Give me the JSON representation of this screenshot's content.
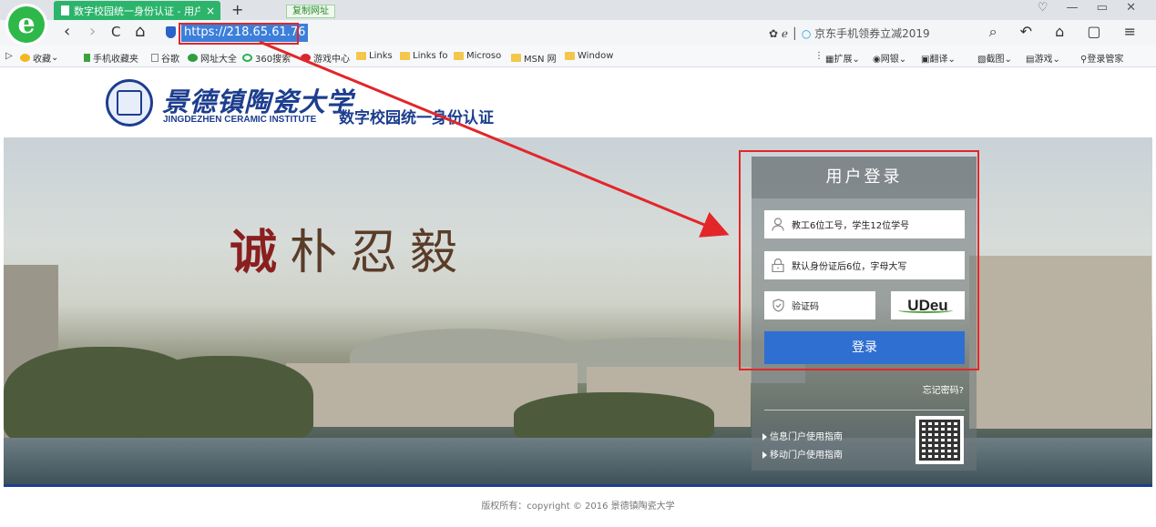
{
  "browser": {
    "tab_title": "数字校园统一身份认证 - 用户登录",
    "tab_close": "×",
    "new_tab": "+",
    "copy_url_label": "复制网址",
    "url": "https://218.65.61.76",
    "search_text": "京东手机领券立减2019",
    "window_controls": "♡ — ▭ ✕",
    "nav": {
      "back": "‹",
      "forward": "›",
      "refresh": "C",
      "home": "⌂"
    },
    "bookmarks": [
      {
        "label": "收藏"
      },
      {
        "label": "手机收藏夹"
      },
      {
        "label": "谷歌"
      },
      {
        "label": "网址大全"
      },
      {
        "label": "360搜索"
      },
      {
        "label": "游戏中心"
      },
      {
        "label": "Links"
      },
      {
        "label": "Links fo"
      },
      {
        "label": "Microso"
      },
      {
        "label": "MSN 网"
      },
      {
        "label": "Window"
      }
    ],
    "toolbar_right": [
      "扩展",
      "网银",
      "翻译",
      "截图",
      "游戏",
      "登录管家"
    ]
  },
  "site": {
    "school_name_cn": "景德镇陶瓷大学",
    "school_name_en": "JINGDEZHEN CERAMIC INSTITUTE",
    "system_name": "数字校园统一身份认证",
    "slogan_1": "诚",
    "slogan_rest": "朴忍毅"
  },
  "login": {
    "title": "用户登录",
    "username_placeholder": "教工6位工号，学生12位学号",
    "password_placeholder": "默认身份证后6位，字母大写",
    "captcha_placeholder": "验证码",
    "captcha_text": "UDeu",
    "submit_label": "登录",
    "forgot_password": "忘记密码?",
    "guide_portal": "信息门户使用指南",
    "guide_mobile": "移动门户使用指南"
  },
  "footer": {
    "copyright": "版权所有：copyright © 2016 景德镇陶瓷大学"
  },
  "colors": {
    "brand_blue": "#1d3e8f",
    "tab_green": "#2cb46c",
    "login_button": "#2f6fd1",
    "annotation_red": "#e2262a"
  }
}
